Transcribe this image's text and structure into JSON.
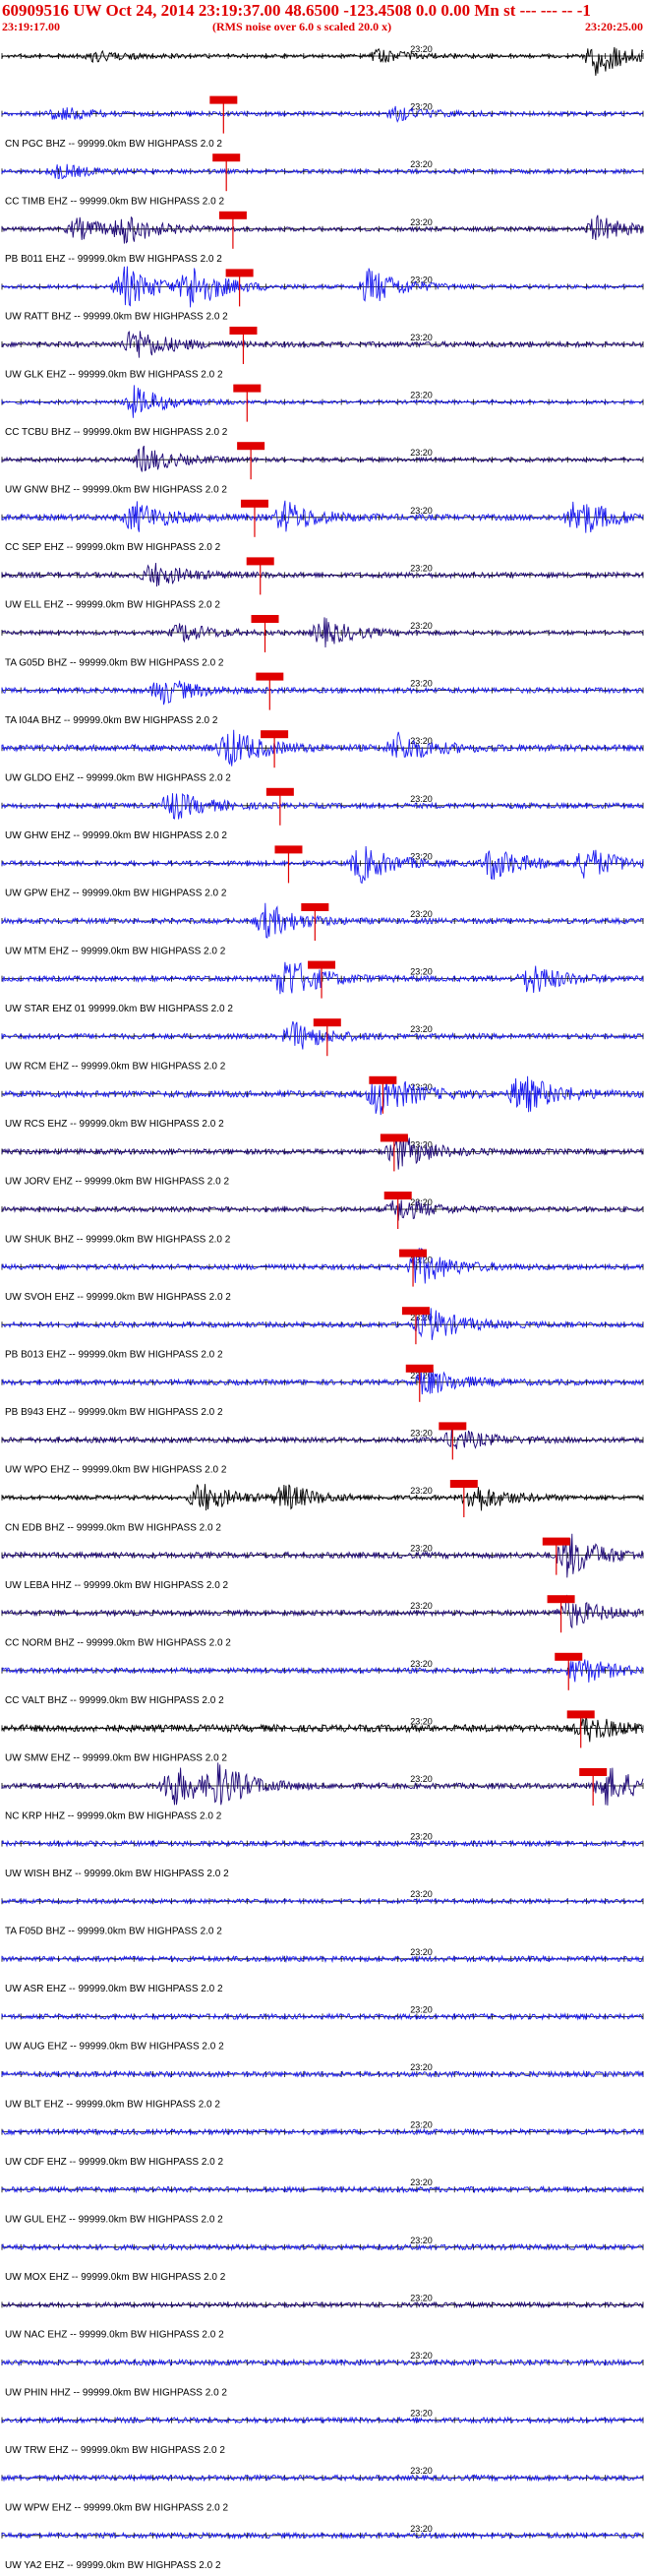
{
  "header": {
    "title": "60909516 UW Oct 24, 2014 23:19:37.00   48.6500  -123.4508  0.0 0.00 Mn st --- --- -- -1",
    "start_time": "23:19:17.00",
    "note": "(RMS noise over 6.0 s scaled 20.0 x)",
    "end_time": "23:20:25.00"
  },
  "colors": {
    "header_text": "#e00000",
    "pick_box": "#e00000",
    "pick_line": "#e00000",
    "trace_blue": "#1c1cf0",
    "trace_navy": "#200a78",
    "trace_black": "#000000",
    "axis": "#000000"
  },
  "chart_data": {
    "type": "seismogram",
    "x_start": "23:19:17.00",
    "x_end": "23:20:25.00",
    "time_tick_label": "23:20",
    "time_tick_time": "23:20:00.00",
    "tick_interval_s": 2,
    "traces": [
      {
        "label": "",
        "pick_time": null,
        "amplitude": 0.3,
        "color": "trace_black",
        "events": [
          {
            "t": 63,
            "a": 1.6
          },
          {
            "t": 10,
            "a": 0.5
          },
          {
            "t": 40,
            "a": 0.5
          }
        ]
      },
      {
        "label": "CN PGC BHZ -- 99999.0km BW  HIGHPASS  2.0  2",
        "pick_time": 23.5,
        "amplitude": 0.35,
        "color": "trace_blue",
        "events": [
          {
            "t": 6,
            "a": 0.6
          },
          {
            "t": 42,
            "a": 0.6
          }
        ]
      },
      {
        "label": "CC TIMB EHZ -- 99999.0km BW  HIGHPASS  2.0  2",
        "pick_time": 23.8,
        "amplitude": 0.35,
        "color": "trace_blue",
        "events": [
          {
            "t": 6,
            "a": 0.6
          }
        ]
      },
      {
        "label": "PB B011 EHZ -- 99999.0km BW  HIGHPASS  2.0  2",
        "pick_time": 24.5,
        "amplitude": 0.35,
        "color": "trace_navy",
        "events": [
          {
            "t": 8,
            "a": 0.9
          },
          {
            "t": 13,
            "a": 1.1
          },
          {
            "t": 63,
            "a": 1.1
          }
        ]
      },
      {
        "label": "UW RATT BHZ -- 99999.0km BW  HIGHPASS  2.0  2",
        "pick_time": 25.2,
        "amplitude": 0.3,
        "color": "trace_blue",
        "events": [
          {
            "t": 13,
            "a": 1.8
          },
          {
            "t": 20,
            "a": 1.8
          },
          {
            "t": 39,
            "a": 1.6
          }
        ]
      },
      {
        "label": "UW GLK EHZ -- 99999.0km BW  HIGHPASS  2.0  2",
        "pick_time": 25.6,
        "amplitude": 0.45,
        "color": "trace_navy",
        "events": [
          {
            "t": 14,
            "a": 1.4
          }
        ]
      },
      {
        "label": "CC TCBU BHZ -- 99999.0km BW  HIGHPASS  2.0  2",
        "pick_time": 26.0,
        "amplitude": 0.3,
        "color": "trace_blue",
        "events": [
          {
            "t": 14,
            "a": 1.3
          }
        ]
      },
      {
        "label": "UW GNW BHZ -- 99999.0km BW  HIGHPASS  2.0  2",
        "pick_time": 26.4,
        "amplitude": 0.35,
        "color": "trace_navy",
        "events": [
          {
            "t": 15,
            "a": 1.1
          }
        ]
      },
      {
        "label": "CC SEP EHZ -- 99999.0km BW  HIGHPASS  2.0  2",
        "pick_time": 26.8,
        "amplitude": 0.5,
        "color": "trace_blue",
        "events": [
          {
            "t": 14,
            "a": 1.3
          },
          {
            "t": 30,
            "a": 1.3
          },
          {
            "t": 61,
            "a": 1.7
          }
        ]
      },
      {
        "label": "UW ELL EHZ -- 99999.0km BW  HIGHPASS  2.0  2",
        "pick_time": 27.4,
        "amplitude": 0.45,
        "color": "trace_navy",
        "events": [
          {
            "t": 16,
            "a": 1.0
          }
        ]
      },
      {
        "label": "TA G05D BHZ -- 99999.0km BW  HIGHPASS  2.0  2",
        "pick_time": 27.9,
        "amplitude": 0.35,
        "color": "trace_navy",
        "events": [
          {
            "t": 34,
            "a": 1.2
          },
          {
            "t": 19,
            "a": 0.8
          }
        ]
      },
      {
        "label": "TA I04A BHZ -- 99999.0km BW  HIGHPASS  2.0  2",
        "pick_time": 28.4,
        "amplitude": 0.45,
        "color": "trace_blue",
        "events": [
          {
            "t": 17,
            "a": 1.1
          }
        ]
      },
      {
        "label": "UW GLDO EHZ -- 99999.0km BW  HIGHPASS  2.0  2",
        "pick_time": 28.9,
        "amplitude": 0.55,
        "color": "trace_blue",
        "events": [
          {
            "t": 24,
            "a": 1.6
          },
          {
            "t": 42,
            "a": 1.2
          }
        ]
      },
      {
        "label": "UW GHW EHZ -- 99999.0km BW  HIGHPASS  2.0  2",
        "pick_time": 29.5,
        "amplitude": 0.45,
        "color": "trace_blue",
        "events": [
          {
            "t": 18,
            "a": 1.2
          }
        ]
      },
      {
        "label": "UW GPW EHZ -- 99999.0km BW  HIGHPASS  2.0  2",
        "pick_time": 30.4,
        "amplitude": 0.4,
        "color": "trace_blue",
        "events": [
          {
            "t": 38,
            "a": 1.6
          },
          {
            "t": 52,
            "a": 1.4
          },
          {
            "t": 62,
            "a": 1.3
          }
        ]
      },
      {
        "label": "UW MTM EHZ -- 99999.0km BW  HIGHPASS  2.0  2",
        "pick_time": 33.2,
        "amplitude": 0.45,
        "color": "trace_blue",
        "events": [
          {
            "t": 28,
            "a": 1.4
          }
        ]
      },
      {
        "label": "UW STAR EHZ 01 99999.0km BW  HIGHPASS  2.0  2",
        "pick_time": 33.9,
        "amplitude": 0.45,
        "color": "trace_blue",
        "events": [
          {
            "t": 30,
            "a": 1.9
          },
          {
            "t": 56,
            "a": 1.3
          }
        ]
      },
      {
        "label": "UW RCM EHZ -- 99999.0km BW  HIGHPASS  2.0  2",
        "pick_time": 34.5,
        "amplitude": 0.45,
        "color": "trace_blue",
        "events": [
          {
            "t": 31,
            "a": 1.2
          }
        ]
      },
      {
        "label": "UW RCS EHZ -- 99999.0km BW  HIGHPASS  2.0  2",
        "pick_time": 40.4,
        "amplitude": 0.55,
        "color": "trace_blue",
        "events": [
          {
            "t": 40,
            "a": 1.9
          },
          {
            "t": 55,
            "a": 1.7
          }
        ]
      },
      {
        "label": "UW JORV EHZ -- 99999.0km BW  HIGHPASS  2.0  2",
        "pick_time": 41.6,
        "amplitude": 0.45,
        "color": "trace_navy",
        "events": [
          {
            "t": 42,
            "a": 1.5
          }
        ]
      },
      {
        "label": "UW SHUK BHZ -- 99999.0km BW  HIGHPASS  2.0  2",
        "pick_time": 42.0,
        "amplitude": 0.4,
        "color": "trace_navy",
        "events": [
          {
            "t": 42,
            "a": 1.0
          }
        ]
      },
      {
        "label": "UW SVOH EHZ -- 99999.0km BW  HIGHPASS  2.0  2",
        "pick_time": 43.6,
        "amplitude": 0.45,
        "color": "trace_blue",
        "events": [
          {
            "t": 44,
            "a": 1.6
          }
        ]
      },
      {
        "label": "PB B013 EHZ -- 99999.0km BW  HIGHPASS  2.0  2",
        "pick_time": 43.9,
        "amplitude": 0.45,
        "color": "trace_blue",
        "events": [
          {
            "t": 45,
            "a": 1.5
          }
        ]
      },
      {
        "label": "PB B943 EHZ -- 99999.0km BW  HIGHPASS  2.0  2",
        "pick_time": 44.3,
        "amplitude": 0.45,
        "color": "trace_blue",
        "events": [
          {
            "t": 45,
            "a": 1.2
          }
        ]
      },
      {
        "label": "UW WPO EHZ -- 99999.0km BW  HIGHPASS  2.0  2",
        "pick_time": 47.8,
        "amplitude": 0.45,
        "color": "trace_navy",
        "events": [
          {
            "t": 48,
            "a": 0.9
          }
        ]
      },
      {
        "label": "CN EDB BHZ -- 99999.0km BW  HIGHPASS  2.0  2",
        "pick_time": 49.0,
        "amplitude": 0.35,
        "color": "trace_black",
        "events": [
          {
            "t": 21,
            "a": 1.3
          },
          {
            "t": 30,
            "a": 1.1
          },
          {
            "t": 50,
            "a": 1.3
          }
        ]
      },
      {
        "label": "UW LEBA HHZ -- 99999.0km BW  HIGHPASS  2.0  2",
        "pick_time": 58.8,
        "amplitude": 0.5,
        "color": "trace_navy",
        "events": [
          {
            "t": 60,
            "a": 1.9
          }
        ]
      },
      {
        "label": "CC NORM BHZ -- 99999.0km BW  HIGHPASS  2.0  2",
        "pick_time": 59.3,
        "amplitude": 0.45,
        "color": "trace_navy",
        "events": [
          {
            "t": 60,
            "a": 1.3
          }
        ]
      },
      {
        "label": "CC VALT BHZ -- 99999.0km BW  HIGHPASS  2.0  2",
        "pick_time": 60.1,
        "amplitude": 0.45,
        "color": "trace_blue",
        "events": [
          {
            "t": 61,
            "a": 1.2
          }
        ]
      },
      {
        "label": "UW SMW EHZ -- 99999.0km BW  HIGHPASS  2.0  2",
        "pick_time": 61.4,
        "amplitude": 0.6,
        "color": "trace_black",
        "events": [
          {
            "t": 62,
            "a": 1.0
          }
        ]
      },
      {
        "label": "NC KRP HHZ -- 99999.0km BW  HIGHPASS  2.0  2",
        "pick_time": 62.7,
        "amplitude": 0.45,
        "color": "trace_navy",
        "events": [
          {
            "t": 18,
            "a": 1.8
          },
          {
            "t": 23,
            "a": 1.5
          },
          {
            "t": 64,
            "a": 1.7
          }
        ]
      },
      {
        "label": "UW WISH BHZ -- 99999.0km BW  HIGHPASS  2.0  2",
        "pick_time": null,
        "amplitude": 0.45,
        "color": "trace_blue",
        "events": []
      },
      {
        "label": "TA F05D BHZ -- 99999.0km BW  HIGHPASS  2.0  2",
        "pick_time": null,
        "amplitude": 0.35,
        "color": "trace_blue",
        "events": []
      },
      {
        "label": "UW ASR EHZ -- 99999.0km BW  HIGHPASS  2.0  2",
        "pick_time": null,
        "amplitude": 0.45,
        "color": "trace_blue",
        "events": []
      },
      {
        "label": "UW AUG EHZ -- 99999.0km BW  HIGHPASS  2.0  2",
        "pick_time": null,
        "amplitude": 0.45,
        "color": "trace_blue",
        "events": []
      },
      {
        "label": "UW BLT EHZ -- 99999.0km BW  HIGHPASS  2.0  2",
        "pick_time": null,
        "amplitude": 0.45,
        "color": "trace_blue",
        "events": []
      },
      {
        "label": "UW CDF EHZ -- 99999.0km BW  HIGHPASS  2.0  2",
        "pick_time": null,
        "amplitude": 0.45,
        "color": "trace_blue",
        "events": []
      },
      {
        "label": "UW GUL EHZ -- 99999.0km BW  HIGHPASS  2.0  2",
        "pick_time": null,
        "amplitude": 0.45,
        "color": "trace_blue",
        "events": []
      },
      {
        "label": "UW MOX EHZ -- 99999.0km BW  HIGHPASS  2.0  2",
        "pick_time": null,
        "amplitude": 0.45,
        "color": "trace_blue",
        "events": []
      },
      {
        "label": "UW NAC EHZ -- 99999.0km BW  HIGHPASS  2.0  2",
        "pick_time": null,
        "amplitude": 0.4,
        "color": "trace_navy",
        "events": []
      },
      {
        "label": "UW PHIN HHZ -- 99999.0km BW  HIGHPASS  2.0  2",
        "pick_time": null,
        "amplitude": 0.45,
        "color": "trace_blue",
        "events": []
      },
      {
        "label": "UW TRW EHZ -- 99999.0km BW  HIGHPASS  2.0  2",
        "pick_time": null,
        "amplitude": 0.45,
        "color": "trace_blue",
        "events": []
      },
      {
        "label": "UW WPW EHZ -- 99999.0km BW  HIGHPASS  2.0  2",
        "pick_time": null,
        "amplitude": 0.45,
        "color": "trace_blue",
        "events": []
      },
      {
        "label": "UW YA2 EHZ -- 99999.0km BW  HIGHPASS  2.0  2",
        "pick_time": null,
        "amplitude": 0.45,
        "color": "trace_blue",
        "events": []
      }
    ]
  }
}
